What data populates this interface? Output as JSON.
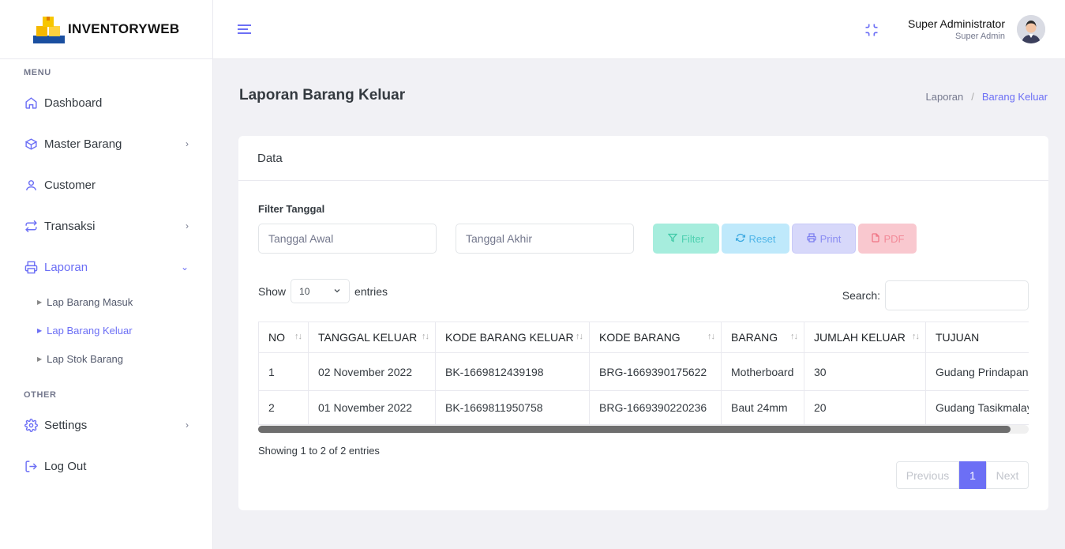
{
  "brand": {
    "name": "INVENTORYWEB"
  },
  "sidebar": {
    "menu_title": "MENU",
    "items": [
      {
        "label": "Dashboard",
        "icon": "home-icon"
      },
      {
        "label": "Master Barang",
        "icon": "box-icon",
        "chevron": "›"
      },
      {
        "label": "Customer",
        "icon": "user-icon"
      },
      {
        "label": "Transaksi",
        "icon": "repeat-icon",
        "chevron": "›"
      },
      {
        "label": "Laporan",
        "icon": "printer-icon",
        "chevron": "⌄"
      }
    ],
    "sub_items": [
      {
        "label": "Lap Barang Masuk"
      },
      {
        "label": "Lap Barang Keluar"
      },
      {
        "label": "Lap Stok Barang"
      }
    ],
    "other_title": "OTHER",
    "other_items": [
      {
        "label": "Settings",
        "icon": "gear-icon",
        "chevron": "›"
      },
      {
        "label": "Log Out",
        "icon": "logout-icon"
      }
    ]
  },
  "header": {
    "user_name": "Super Administrator",
    "user_role": "Super Admin"
  },
  "page": {
    "title": "Laporan Barang Keluar",
    "breadcrumb": [
      "Laporan",
      "/",
      "Barang Keluar"
    ]
  },
  "card": {
    "title": "Data",
    "filter_label": "Filter Tanggal",
    "start_placeholder": "Tanggal Awal",
    "end_placeholder": "Tanggal Akhir",
    "buttons": {
      "filter": "Filter",
      "reset": "Reset",
      "print": "Print",
      "pdf": "PDF"
    },
    "show_label": "Show",
    "entries_value": "10",
    "entries_label": "entries",
    "search_label": "Search:",
    "columns": [
      "NO",
      "TANGGAL KELUAR",
      "KODE BARANG KELUAR",
      "KODE BARANG",
      "BARANG",
      "JUMLAH KELUAR",
      "TUJUAN"
    ],
    "rows": [
      [
        "1",
        "02 November 2022",
        "BK-1669812439198",
        "BRG-1669390175622",
        "Motherboard",
        "30",
        "Gudang Prindapan"
      ],
      [
        "2",
        "01 November 2022",
        "BK-1669811950758",
        "BRG-1669390220236",
        "Baut 24mm",
        "20",
        "Gudang Tasikmalaya"
      ]
    ],
    "info": "Showing 1 to 2 of 2 entries",
    "pager": {
      "prev": "Previous",
      "current": "1",
      "next": "Next"
    }
  },
  "colors": {
    "accent": "#6c6ff5",
    "filter": "#a6eddd",
    "reset": "#bfe9fb",
    "print": "#d7d8fa",
    "pdf": "#f9c8cf"
  }
}
